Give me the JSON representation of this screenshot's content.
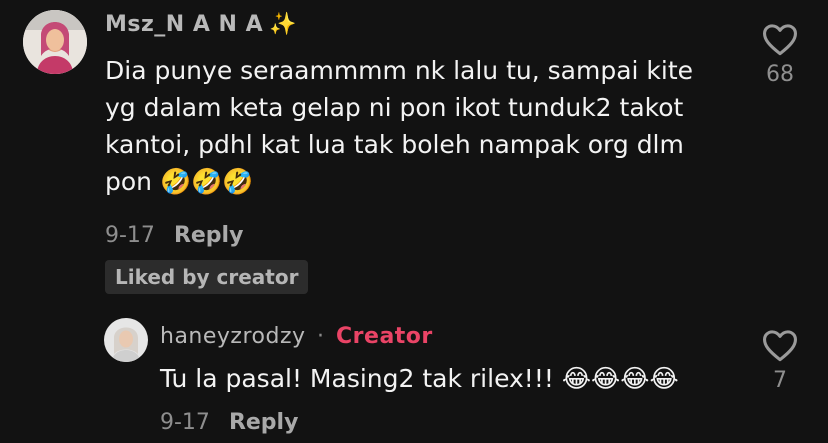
{
  "comments": [
    {
      "username": "Msz_N A N A",
      "sparkle_emoji": "✨",
      "text_lines": [
        "Dia punye seraammmm nk lalu tu, sampai kite",
        "yg dalam keta gelap ni pon ikot tunduk2 takot",
        "kantoi, pdhl kat lua tak boleh nampak org dlm",
        "pon"
      ],
      "emojis": "🤣🤣🤣",
      "date": "9-17",
      "reply_label": "Reply",
      "badge": "Liked by creator",
      "like_count": "68"
    },
    {
      "username": "haneyzrodzy",
      "separator": "·",
      "creator_label": "Creator",
      "text": "Tu la pasal! Masing2 tak rilex!!!",
      "emojis": "😂😂😂😂",
      "date": "9-17",
      "reply_label": "Reply",
      "like_count": "7"
    }
  ],
  "colors": {
    "background": "#121212",
    "creator_accent": "#ea4466",
    "sparkle": "#f3c94a"
  },
  "icons": [
    "avatar-icon",
    "heart-outline-icon"
  ]
}
